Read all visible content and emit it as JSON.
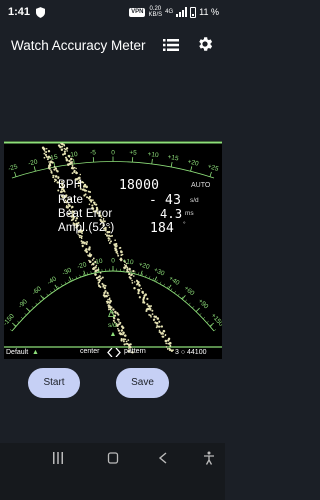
{
  "status_bar": {
    "time": "1:41",
    "vpn_label": "VPN",
    "net_speed_value": "0.20",
    "net_speed_unit": "KB/S",
    "network_label": "4G",
    "battery": "11 %"
  },
  "app_bar": {
    "title": "Watch Accuracy Meter",
    "menu_icon": "list-icon",
    "settings_icon": "gear-icon"
  },
  "meter": {
    "colors": {
      "scale": "#8ee07a",
      "trace": "#e6e3b4",
      "background": "#000000"
    },
    "top_scale_labels": [
      "-25",
      "-20",
      "-15",
      "-10",
      "-5",
      "0",
      "+5",
      "+10",
      "+15",
      "+20",
      "+25"
    ],
    "arc_scale_labels": [
      "-150",
      "-90",
      "-60",
      "-40",
      "-30",
      "-20",
      "-10",
      "0",
      "+10",
      "+20",
      "+30",
      "+40",
      "+60",
      "+90",
      "+150"
    ],
    "readouts": {
      "bph_label": "BPH",
      "bph_value": "18000",
      "bph_mode": "AUTO",
      "rate_label": "Rate",
      "rate_value": "- 43",
      "rate_unit": "s/d",
      "beat_error_label": "Beat Error",
      "beat_error_value": "4.3",
      "beat_error_unit": "ms",
      "amplitude_label": "Ampl.(52°)",
      "amplitude_value": "184",
      "amplitude_unit": "°"
    },
    "delta_symbol": "Δ",
    "delta_unit": "s/d",
    "bottom": {
      "preset": "Default",
      "center_label": "center",
      "pattern_label": "pattern",
      "counter": "3 ○ 44100"
    }
  },
  "buttons": {
    "start": "Start",
    "save": "Save"
  },
  "nav_bar": {
    "icons": [
      "menu-icon",
      "home-icon",
      "back-icon",
      "accessibility-icon"
    ]
  }
}
